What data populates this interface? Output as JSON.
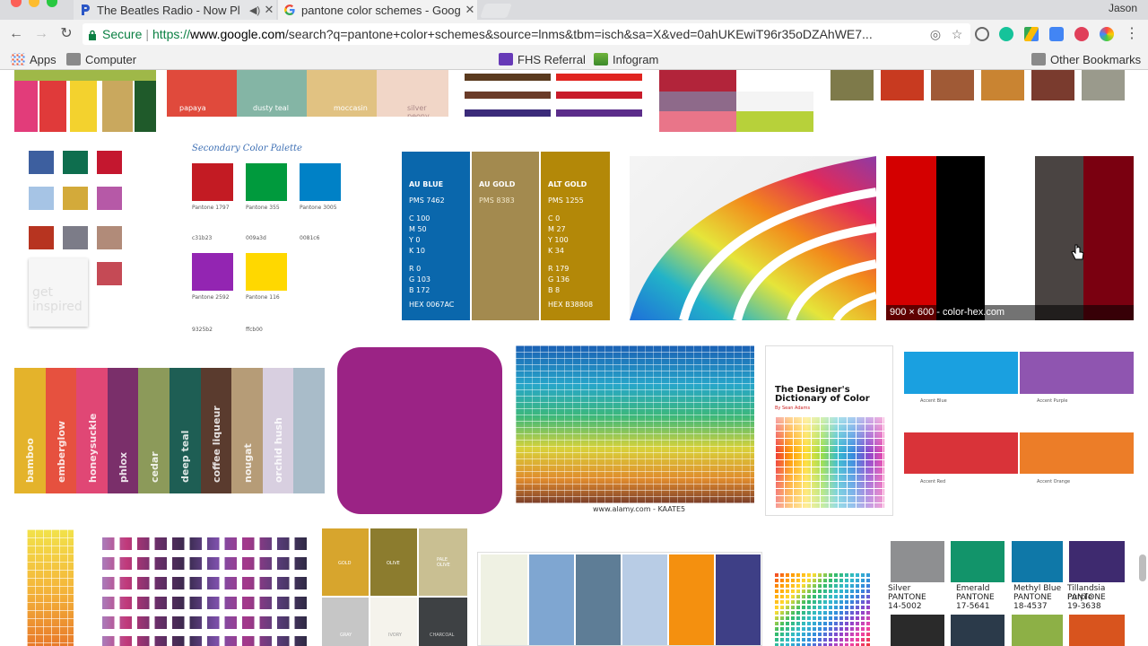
{
  "browser": {
    "tabs": [
      {
        "title": "The Beatles Radio - Now Pl",
        "active": false
      },
      {
        "title": "pantone color schemes - Goog",
        "active": true
      }
    ],
    "user": "Jason",
    "secure_label": "Secure",
    "url": {
      "scheme": "https://",
      "host": "www.google.com",
      "path": "/search?q=pantone+color+schemes&source=lnms&tbm=isch&sa=X&ved=0ahUKEwiT96r35oDZAhWE7..."
    },
    "bookmarks": {
      "apps": "Apps",
      "computer": "Computer",
      "fhs": "FHS Referral",
      "infogram": "Infogram",
      "other": "Other Bookmarks"
    }
  },
  "images": {
    "row0_labels": [
      "papaya",
      "dusty teal",
      "moccasin",
      "silver peony"
    ],
    "palette2_title": "Secondary Color Palette",
    "palette2_codes": [
      "Pantone 1797",
      "Pantone 355",
      "Pantone 3005",
      "Pantone 2592",
      "Pantone 116"
    ],
    "palette2_hex": [
      "c31b23",
      "009a3d",
      "0081c6",
      "9325b2",
      "ffcb00"
    ],
    "get_inspired": "get inspired",
    "au": [
      {
        "name": "AU BLUE",
        "pms": "PMS 7462",
        "c": "C  100",
        "m": "M  50",
        "y": "Y  0",
        "k": "K  10",
        "r": "R  0",
        "g": "G  103",
        "b": "B  172",
        "hex": "HEX 0067AC",
        "color": "#0a67ac"
      },
      {
        "name": "AU GOLD",
        "pms": "PMS 8383",
        "c": "",
        "m": "",
        "y": "",
        "k": "",
        "r": "",
        "g": "",
        "b": "",
        "hex": "",
        "color": "#a38a4f"
      },
      {
        "name": "ALT GOLD",
        "pms": "PMS 1255",
        "c": "C  0",
        "m": "M  27",
        "y": "Y  100",
        "k": "K  34",
        "r": "R  179",
        "g": "G  136",
        "b": "B  8",
        "hex": "HEX B38808",
        "color": "#b38808"
      }
    ],
    "colorhex_caption": "900 × 600 - color-hex.com",
    "stripes": [
      "bamboo",
      "emberglow",
      "honeysuckle",
      "phlox",
      "cedar",
      "deep teal",
      "coffee liqueur",
      "nougat",
      "orchid hush",
      ""
    ],
    "alamy_caption": "www.alamy.com - KAATE5",
    "book_title": "The Designer's Dictionary of Color",
    "book_author": "By Sean Adams",
    "accents": [
      "Accent Blue",
      "Accent Purple",
      "Accent Red",
      "Accent Orange"
    ],
    "gold_labels": [
      "GOLD",
      "OLIVE",
      "PALE OLIVE",
      "GRAY",
      "IVORY",
      "CHARCOAL"
    ],
    "pantone_bottom": [
      {
        "name": "Silver",
        "brand": "PANTONE",
        "code": "14-5002",
        "color": "#8e8f91"
      },
      {
        "name": "Emerald",
        "brand": "PANTONE",
        "code": "17-5641",
        "color": "#12946a"
      },
      {
        "name": "Methyl Blue",
        "brand": "PANTONE",
        "code": "18-4537",
        "color": "#0f78a8"
      },
      {
        "name": "Tillandsia Purple",
        "brand": "PANTONE",
        "code": "19-3638",
        "color": "#3e2a6f"
      }
    ]
  }
}
